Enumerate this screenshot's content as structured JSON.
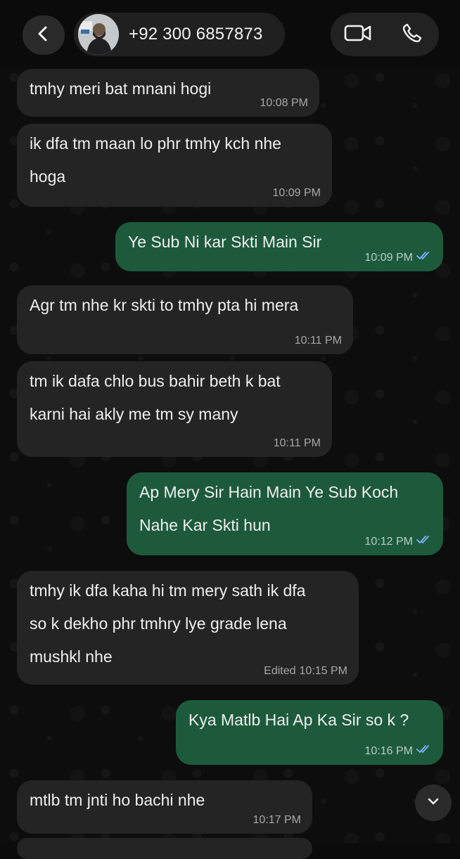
{
  "header": {
    "contact_name": "+92 300 6857873",
    "back_icon": "chevron-left-icon",
    "video_icon": "video-camera-icon",
    "phone_icon": "phone-icon"
  },
  "messages": [
    {
      "direction": "in",
      "text": "tmhy meri bat mnani hogi",
      "time": "10:08 PM"
    },
    {
      "direction": "in",
      "text": "ik dfa tm maan lo phr tmhy kch nhe\nhoga",
      "time": "10:09 PM"
    },
    {
      "direction": "out",
      "text": "Ye Sub Ni kar Skti Main Sir",
      "time": "10:09 PM",
      "status": "read"
    },
    {
      "direction": "in",
      "text": "Agr tm nhe kr skti to tmhy pta hi mera",
      "time": "10:11 PM"
    },
    {
      "direction": "in",
      "text": "tm ik dafa chlo bus bahir beth k bat\nkarni hai akly me tm sy many",
      "time": "10:11 PM"
    },
    {
      "direction": "out",
      "text": "Ap Mery Sir Hain Main Ye Sub Koch\nNahe Kar Skti hun",
      "time": "10:12 PM",
      "status": "read"
    },
    {
      "direction": "in",
      "text": "tmhy ik dfa kaha hi tm mery sath ik dfa\nso k dekho phr tmhry lye grade lena\nmushkl nhe",
      "time": "10:15 PM",
      "edited": "Edited"
    },
    {
      "direction": "out",
      "text": "Kya Matlb Hai Ap Ka Sir so k ?",
      "time": "10:16 PM",
      "status": "read"
    },
    {
      "direction": "in",
      "text": "mtlb tm jnti ho bachi nhe",
      "time": "10:17 PM"
    }
  ],
  "colors": {
    "incoming_bubble": "#242424",
    "outgoing_bubble": "#1d5a3c",
    "read_ticks": "#7fb3ff"
  },
  "scroll_button_icon": "chevron-down-icon"
}
